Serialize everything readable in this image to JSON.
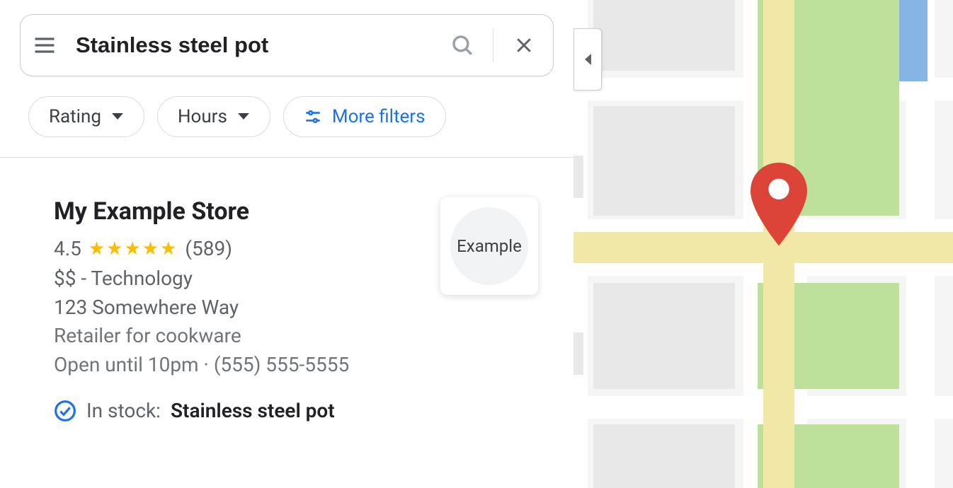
{
  "search": {
    "query": "Stainless steel pot"
  },
  "filters": {
    "rating_label": "Rating",
    "hours_label": "Hours",
    "more_label": "More filters"
  },
  "result": {
    "name": "My Example Store",
    "rating": "4.5",
    "stars": "★★★★★",
    "review_count": "(589)",
    "price_category": "$$ - Technology",
    "address": "123 Somewhere Way",
    "description": "Retailer for cookware",
    "hours_phone": "Open until 10pm · (555) 555-5555",
    "stock_label": "In stock:",
    "stock_product": "Stainless steel pot",
    "thumb_label": "Example"
  },
  "colors": {
    "accent": "#1a73e8",
    "star": "#fbbc04",
    "pin": "#db4437"
  }
}
